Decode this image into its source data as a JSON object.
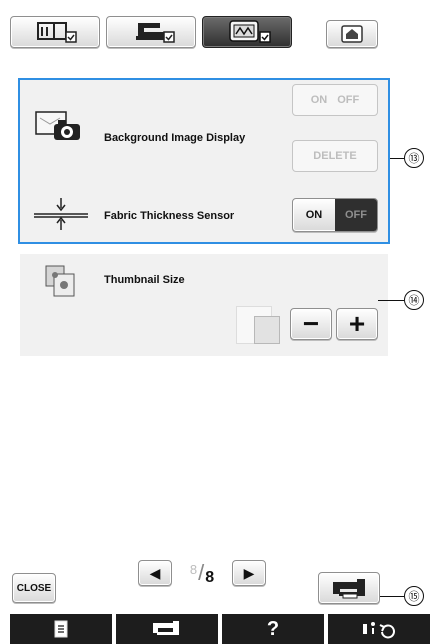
{
  "header": {
    "tabs": [
      {
        "name": "basic-settings-tab",
        "icon": "book-checkbox-icon"
      },
      {
        "name": "sewing-settings-tab",
        "icon": "machine-checkbox-icon"
      },
      {
        "name": "embroidery-settings-tab",
        "icon": "embroidery-frame-checkbox-icon"
      }
    ],
    "home_icon": "home-icon"
  },
  "settings": {
    "background_image": {
      "label": "Background Image Display",
      "toggle_on": "ON",
      "toggle_off": "OFF",
      "delete_label": "DELETE",
      "state": "disabled"
    },
    "fabric_thickness": {
      "label": "Fabric Thickness Sensor",
      "toggle_on": "ON",
      "toggle_off": "OFF",
      "state": "off"
    },
    "thumbnail": {
      "label": "Thumbnail Size",
      "minus": "−",
      "plus": "+"
    }
  },
  "callouts": {
    "c13": "⑬",
    "c14": "⑭",
    "c15": "⑮"
  },
  "pager": {
    "page_current": "8",
    "page_total": "8",
    "page_text": "8/8"
  },
  "footer": {
    "close_label": "CLOSE",
    "bottom_bar": [
      {
        "name": "document-icon",
        "glyph": "▤"
      },
      {
        "name": "sewing-machine-icon",
        "glyph": "⌂"
      },
      {
        "name": "help-icon",
        "glyph": "?"
      },
      {
        "name": "info-rotate-icon",
        "glyph": "ℹ⟳"
      }
    ]
  },
  "colors": {
    "highlight_border": "#2f8fe3",
    "panel_bg": "#f1f1f1",
    "dark_button": "#2f2f2f"
  }
}
